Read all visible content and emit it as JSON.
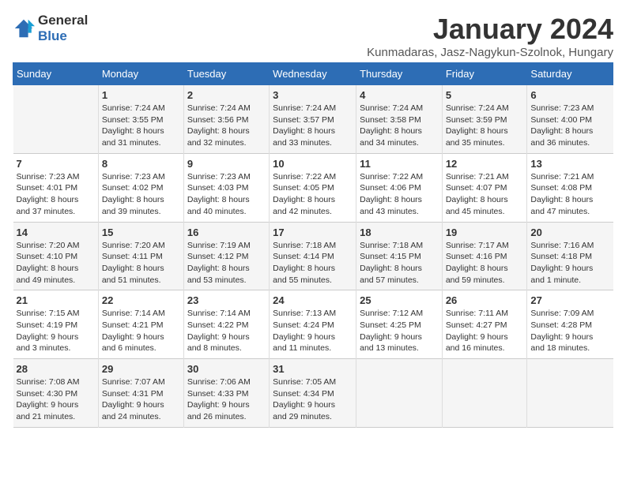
{
  "header": {
    "logo": {
      "line1": "General",
      "line2": "Blue"
    },
    "title": "January 2024",
    "subtitle": "Kunmadaras, Jasz-Nagykun-Szolnok, Hungary"
  },
  "weekdays": [
    "Sunday",
    "Monday",
    "Tuesday",
    "Wednesday",
    "Thursday",
    "Friday",
    "Saturday"
  ],
  "weeks": [
    [
      {
        "day": "",
        "info": ""
      },
      {
        "day": "1",
        "info": "Sunrise: 7:24 AM\nSunset: 3:55 PM\nDaylight: 8 hours\nand 31 minutes."
      },
      {
        "day": "2",
        "info": "Sunrise: 7:24 AM\nSunset: 3:56 PM\nDaylight: 8 hours\nand 32 minutes."
      },
      {
        "day": "3",
        "info": "Sunrise: 7:24 AM\nSunset: 3:57 PM\nDaylight: 8 hours\nand 33 minutes."
      },
      {
        "day": "4",
        "info": "Sunrise: 7:24 AM\nSunset: 3:58 PM\nDaylight: 8 hours\nand 34 minutes."
      },
      {
        "day": "5",
        "info": "Sunrise: 7:24 AM\nSunset: 3:59 PM\nDaylight: 8 hours\nand 35 minutes."
      },
      {
        "day": "6",
        "info": "Sunrise: 7:23 AM\nSunset: 4:00 PM\nDaylight: 8 hours\nand 36 minutes."
      }
    ],
    [
      {
        "day": "7",
        "info": "Sunrise: 7:23 AM\nSunset: 4:01 PM\nDaylight: 8 hours\nand 37 minutes."
      },
      {
        "day": "8",
        "info": "Sunrise: 7:23 AM\nSunset: 4:02 PM\nDaylight: 8 hours\nand 39 minutes."
      },
      {
        "day": "9",
        "info": "Sunrise: 7:23 AM\nSunset: 4:03 PM\nDaylight: 8 hours\nand 40 minutes."
      },
      {
        "day": "10",
        "info": "Sunrise: 7:22 AM\nSunset: 4:05 PM\nDaylight: 8 hours\nand 42 minutes."
      },
      {
        "day": "11",
        "info": "Sunrise: 7:22 AM\nSunset: 4:06 PM\nDaylight: 8 hours\nand 43 minutes."
      },
      {
        "day": "12",
        "info": "Sunrise: 7:21 AM\nSunset: 4:07 PM\nDaylight: 8 hours\nand 45 minutes."
      },
      {
        "day": "13",
        "info": "Sunrise: 7:21 AM\nSunset: 4:08 PM\nDaylight: 8 hours\nand 47 minutes."
      }
    ],
    [
      {
        "day": "14",
        "info": "Sunrise: 7:20 AM\nSunset: 4:10 PM\nDaylight: 8 hours\nand 49 minutes."
      },
      {
        "day": "15",
        "info": "Sunrise: 7:20 AM\nSunset: 4:11 PM\nDaylight: 8 hours\nand 51 minutes."
      },
      {
        "day": "16",
        "info": "Sunrise: 7:19 AM\nSunset: 4:12 PM\nDaylight: 8 hours\nand 53 minutes."
      },
      {
        "day": "17",
        "info": "Sunrise: 7:18 AM\nSunset: 4:14 PM\nDaylight: 8 hours\nand 55 minutes."
      },
      {
        "day": "18",
        "info": "Sunrise: 7:18 AM\nSunset: 4:15 PM\nDaylight: 8 hours\nand 57 minutes."
      },
      {
        "day": "19",
        "info": "Sunrise: 7:17 AM\nSunset: 4:16 PM\nDaylight: 8 hours\nand 59 minutes."
      },
      {
        "day": "20",
        "info": "Sunrise: 7:16 AM\nSunset: 4:18 PM\nDaylight: 9 hours\nand 1 minute."
      }
    ],
    [
      {
        "day": "21",
        "info": "Sunrise: 7:15 AM\nSunset: 4:19 PM\nDaylight: 9 hours\nand 3 minutes."
      },
      {
        "day": "22",
        "info": "Sunrise: 7:14 AM\nSunset: 4:21 PM\nDaylight: 9 hours\nand 6 minutes."
      },
      {
        "day": "23",
        "info": "Sunrise: 7:14 AM\nSunset: 4:22 PM\nDaylight: 9 hours\nand 8 minutes."
      },
      {
        "day": "24",
        "info": "Sunrise: 7:13 AM\nSunset: 4:24 PM\nDaylight: 9 hours\nand 11 minutes."
      },
      {
        "day": "25",
        "info": "Sunrise: 7:12 AM\nSunset: 4:25 PM\nDaylight: 9 hours\nand 13 minutes."
      },
      {
        "day": "26",
        "info": "Sunrise: 7:11 AM\nSunset: 4:27 PM\nDaylight: 9 hours\nand 16 minutes."
      },
      {
        "day": "27",
        "info": "Sunrise: 7:09 AM\nSunset: 4:28 PM\nDaylight: 9 hours\nand 18 minutes."
      }
    ],
    [
      {
        "day": "28",
        "info": "Sunrise: 7:08 AM\nSunset: 4:30 PM\nDaylight: 9 hours\nand 21 minutes."
      },
      {
        "day": "29",
        "info": "Sunrise: 7:07 AM\nSunset: 4:31 PM\nDaylight: 9 hours\nand 24 minutes."
      },
      {
        "day": "30",
        "info": "Sunrise: 7:06 AM\nSunset: 4:33 PM\nDaylight: 9 hours\nand 26 minutes."
      },
      {
        "day": "31",
        "info": "Sunrise: 7:05 AM\nSunset: 4:34 PM\nDaylight: 9 hours\nand 29 minutes."
      },
      {
        "day": "",
        "info": ""
      },
      {
        "day": "",
        "info": ""
      },
      {
        "day": "",
        "info": ""
      }
    ]
  ]
}
